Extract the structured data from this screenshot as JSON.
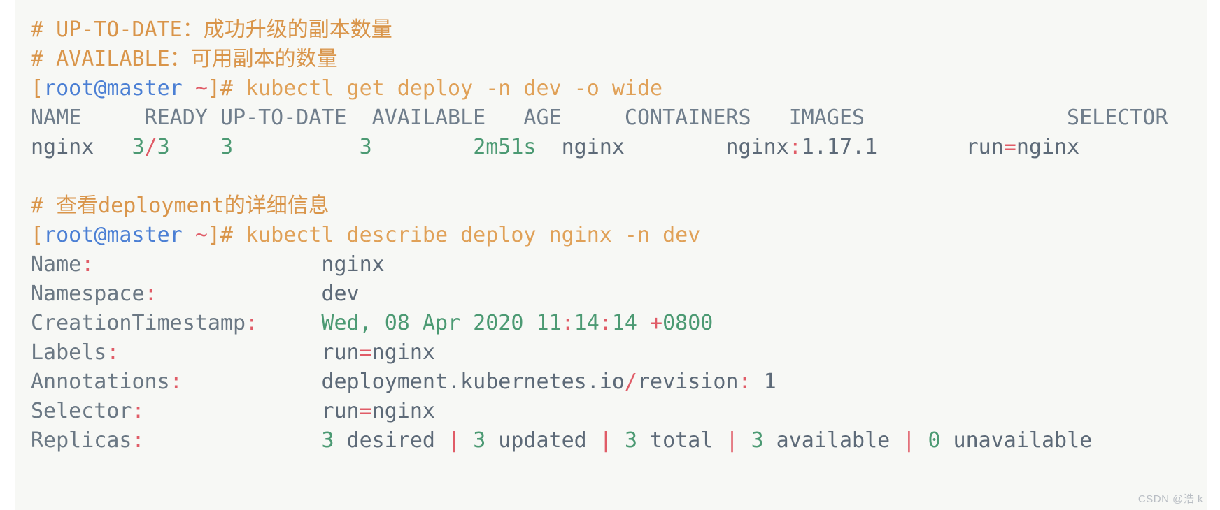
{
  "terminal": {
    "background_color": "#f7f8f5",
    "colors": {
      "comment": "#d9954a",
      "prompt_user_host": "#4b7fd4",
      "tilde": "#e05c67",
      "bracket_hash": "#d9954a",
      "command": "#e0a158",
      "table_header": "#707e8c",
      "plain_text": "#5d6a78",
      "number_green": "#4c9a73",
      "separator_red": "#e05c67"
    },
    "lines": [
      {
        "name": "comment-up-to-date",
        "type": "comment",
        "text": "# UP-TO-DATE：成功升级的副本数量"
      },
      {
        "name": "comment-available",
        "type": "comment",
        "text": "# AVAILABLE：可用副本的数量"
      },
      {
        "name": "prompt-get-deploy",
        "type": "prompt",
        "prompt_open": "[",
        "user_host": "root@master",
        "space": " ",
        "tilde": "~",
        "prompt_close": "]# ",
        "command": "kubectl get deploy -n dev -o wide"
      },
      {
        "name": "table-header-row",
        "type": "table-header",
        "text": "NAME     READY UP-TO-DATE  AVAILABLE   AGE     CONTAINERS   IMAGES                SELECTOR"
      },
      {
        "name": "table-data-row",
        "type": "table-data",
        "segments": [
          {
            "text": "nginx   ",
            "color": "plain"
          },
          {
            "text": "3",
            "color": "green"
          },
          {
            "text": "/",
            "color": "red"
          },
          {
            "text": "3",
            "color": "green"
          },
          {
            "text": "    ",
            "color": "plain"
          },
          {
            "text": "3",
            "color": "green"
          },
          {
            "text": "          ",
            "color": "plain"
          },
          {
            "text": "3",
            "color": "green"
          },
          {
            "text": "        ",
            "color": "plain"
          },
          {
            "text": "2m51s",
            "color": "green"
          },
          {
            "text": "  nginx        nginx",
            "color": "plain"
          },
          {
            "text": ":",
            "color": "red"
          },
          {
            "text": "1.17.1       run",
            "color": "plain"
          },
          {
            "text": "=",
            "color": "red"
          },
          {
            "text": "nginx",
            "color": "plain"
          }
        ]
      },
      {
        "name": "spacer-1",
        "type": "blank",
        "text": ""
      },
      {
        "name": "comment-describe-deployment",
        "type": "comment",
        "text": "# 查看deployment的详细信息"
      },
      {
        "name": "prompt-describe-deploy",
        "type": "prompt",
        "prompt_open": "[",
        "user_host": "root@master",
        "space": " ",
        "tilde": "~",
        "prompt_close": "]# ",
        "command": "kubectl describe deploy nginx -n dev"
      },
      {
        "name": "field-name",
        "type": "field",
        "key": "Name",
        "colon": ":",
        "pad": "                  ",
        "value_segments": [
          {
            "text": "nginx",
            "color": "plain"
          }
        ]
      },
      {
        "name": "field-namespace",
        "type": "field",
        "key": "Namespace",
        "colon": ":",
        "pad": "             ",
        "value_segments": [
          {
            "text": "dev",
            "color": "plain"
          }
        ]
      },
      {
        "name": "field-creationtimestamp",
        "type": "field",
        "key": "CreationTimestamp",
        "colon": ":",
        "pad": "     ",
        "value_segments": [
          {
            "text": "Wed, 08 Apr 2020 11",
            "color": "green"
          },
          {
            "text": ":",
            "color": "red"
          },
          {
            "text": "14",
            "color": "green"
          },
          {
            "text": ":",
            "color": "red"
          },
          {
            "text": "14 ",
            "color": "green"
          },
          {
            "text": "+",
            "color": "red"
          },
          {
            "text": "0800",
            "color": "green"
          }
        ]
      },
      {
        "name": "field-labels",
        "type": "field",
        "key": "Labels",
        "colon": ":",
        "pad": "                ",
        "value_segments": [
          {
            "text": "run",
            "color": "plain"
          },
          {
            "text": "=",
            "color": "red"
          },
          {
            "text": "nginx",
            "color": "plain"
          }
        ]
      },
      {
        "name": "field-annotations",
        "type": "field",
        "key": "Annotations",
        "colon": ":",
        "pad": "           ",
        "value_segments": [
          {
            "text": "deployment.kubernetes.io",
            "color": "plain"
          },
          {
            "text": "/",
            "color": "red"
          },
          {
            "text": "revision",
            "color": "plain"
          },
          {
            "text": ":",
            "color": "red"
          },
          {
            "text": " 1",
            "color": "plain"
          }
        ]
      },
      {
        "name": "field-selector",
        "type": "field",
        "key": "Selector",
        "colon": ":",
        "pad": "              ",
        "value_segments": [
          {
            "text": "run",
            "color": "plain"
          },
          {
            "text": "=",
            "color": "red"
          },
          {
            "text": "nginx",
            "color": "plain"
          }
        ]
      },
      {
        "name": "field-replicas",
        "type": "field",
        "key": "Replicas",
        "colon": ":",
        "pad": "              ",
        "value_segments": [
          {
            "text": "3",
            "color": "green"
          },
          {
            "text": " desired ",
            "color": "plain"
          },
          {
            "text": "|",
            "color": "red"
          },
          {
            "text": " ",
            "color": "plain"
          },
          {
            "text": "3",
            "color": "green"
          },
          {
            "text": " updated ",
            "color": "plain"
          },
          {
            "text": "|",
            "color": "red"
          },
          {
            "text": " ",
            "color": "plain"
          },
          {
            "text": "3",
            "color": "green"
          },
          {
            "text": " total ",
            "color": "plain"
          },
          {
            "text": "|",
            "color": "red"
          },
          {
            "text": " ",
            "color": "plain"
          },
          {
            "text": "3",
            "color": "green"
          },
          {
            "text": " available ",
            "color": "plain"
          },
          {
            "text": "|",
            "color": "red"
          },
          {
            "text": " ",
            "color": "plain"
          },
          {
            "text": "0",
            "color": "green"
          },
          {
            "text": " unavailable",
            "color": "plain"
          }
        ]
      }
    ]
  },
  "watermark": {
    "text": "CSDN @浩 k"
  }
}
